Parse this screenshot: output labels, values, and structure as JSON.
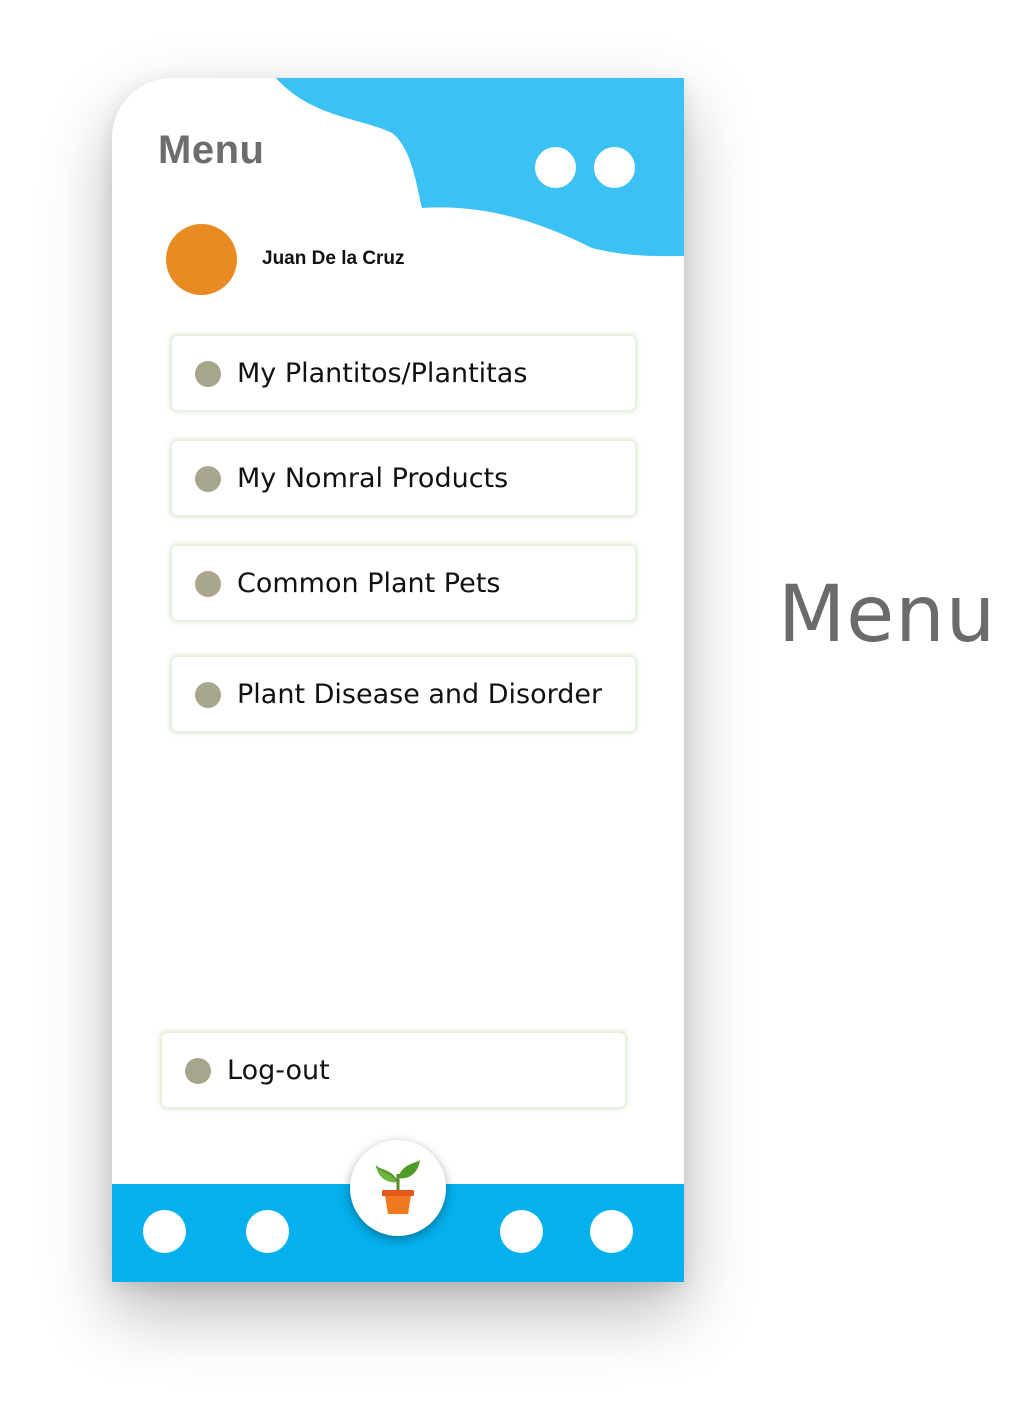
{
  "colors": {
    "accent_blue": "#3bc1f4",
    "bottom_bar_blue": "#04b0ee",
    "avatar_orange": "#e98b23",
    "bullet_gray": "#a7a58b",
    "title_gray": "#6d6d6d"
  },
  "header": {
    "title": "Menu",
    "icons": [
      "circle-button",
      "circle-button"
    ]
  },
  "user": {
    "name": "Juan De la Cruz",
    "avatar_icon": "avatar-circle"
  },
  "menu": {
    "items": [
      {
        "label": "My Plantitos/Plantitas"
      },
      {
        "label": "My Nomral Products"
      },
      {
        "label": "Common Plant Pets"
      },
      {
        "label": "Plant Disease and Disorder"
      }
    ],
    "logout_label": "Log-out"
  },
  "bottom_nav": {
    "center_icon": "potted-plant-icon",
    "icons": [
      "nav-circle",
      "nav-circle",
      "nav-circle",
      "nav-circle"
    ]
  },
  "side_caption": "Menu"
}
